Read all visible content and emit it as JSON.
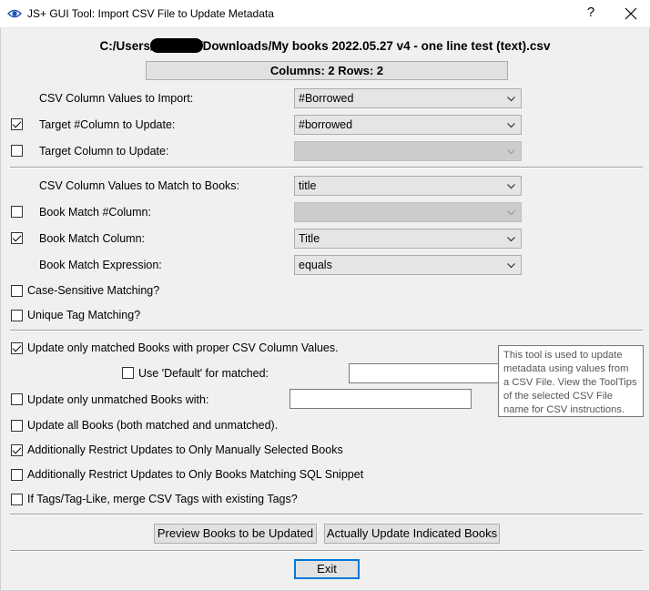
{
  "window": {
    "title": "JS+ GUI Tool:  Import CSV File to Update Metadata",
    "help_label": "?"
  },
  "file": {
    "path_prefix": "C:/Users/",
    "path_suffix": "/Downloads/My books 2022.05.27 v4 - one line test (text).csv",
    "info": "Columns: 2  Rows: 2"
  },
  "import": {
    "csv_values_label": "CSV Column Values to Import:",
    "csv_values_value": "#Borrowed",
    "target_custom_label": "Target #Column to Update:",
    "target_custom_checked": true,
    "target_custom_value": "#borrowed",
    "target_std_label": "Target Column to Update:",
    "target_std_checked": false,
    "target_std_value": ""
  },
  "match": {
    "csv_match_label": "CSV Column Values to Match to Books:",
    "csv_match_value": "title",
    "book_custom_label": "Book Match #Column:",
    "book_custom_checked": false,
    "book_custom_value": "",
    "book_std_label": "Book Match Column:",
    "book_std_checked": true,
    "book_std_value": "Title",
    "expression_label": "Book Match Expression:",
    "expression_value": "equals",
    "case_sensitive_label": "Case-Sensitive Matching?",
    "case_sensitive_checked": false,
    "unique_tag_label": "Unique Tag Matching?",
    "unique_tag_checked": false
  },
  "options": {
    "update_matched_label": "Update only matched Books with proper CSV Column Values.",
    "update_matched_checked": true,
    "use_default_label": "Use 'Default' for matched:",
    "use_default_checked": false,
    "use_default_value": "",
    "update_unmatched_label": "Update only unmatched Books with:",
    "update_unmatched_checked": false,
    "update_unmatched_value": "",
    "update_all_label": "Update all Books (both matched and unmatched).",
    "update_all_checked": false,
    "restrict_selected_label": "Additionally Restrict Updates to Only Manually Selected Books",
    "restrict_selected_checked": true,
    "restrict_sql_label": "Additionally Restrict Updates to Only Books Matching SQL Snippet",
    "restrict_sql_checked": false,
    "merge_tags_label": "If Tags/Tag-Like, merge CSV Tags with existing Tags?",
    "merge_tags_checked": false
  },
  "tooltip": {
    "line1": "This tool is used to update",
    "line2": "metadata using values from",
    "line3": "a CSV File. View the ToolTips",
    "line4": "of the selected CSV File",
    "line5": "name for CSV instructions."
  },
  "buttons": {
    "preview": "Preview Books to be Updated",
    "update": "Actually Update Indicated Books",
    "exit": "Exit"
  },
  "colors": {
    "focus_border": "#0078d7",
    "window_bg": "#f0f0f0",
    "titlebar_bg": "#ffffff"
  },
  "icons": {
    "app": "eye-icon",
    "close": "close-icon",
    "dropdown": "chevron-down-icon"
  }
}
